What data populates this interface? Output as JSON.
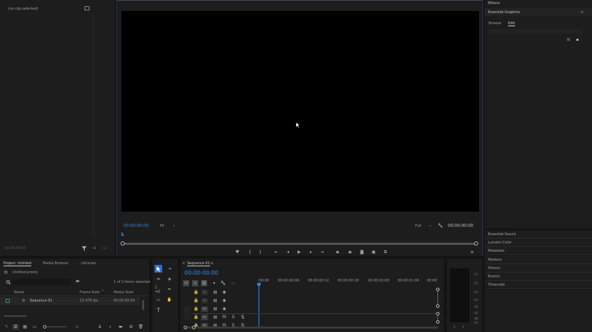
{
  "source_panel": {
    "title": "(no clip selected)",
    "bottom_left": "00:00:00:00"
  },
  "program": {
    "timecode_left": "00:00:00:00",
    "fit": "Fit",
    "quality": "Full",
    "timecode_right": "00:00:00:00"
  },
  "effects_panel": {
    "title": "Effects",
    "essential_graphics": "Essential Graphics",
    "tabs": [
      "Browse",
      "Edit"
    ],
    "active_tab": "Edit"
  },
  "right_panels": [
    "Essential Sound",
    "Lumetri Color",
    "Metadata",
    "Markers",
    "History",
    "Events",
    "Timecode"
  ],
  "project": {
    "tabs": [
      "Project: Untitled",
      "Media Browser",
      "Libraries"
    ],
    "file": "Untitled.prproj",
    "item_count": "1 of 2 items selected",
    "columns": [
      "Name",
      "Frame Rate",
      "Media Start"
    ],
    "rows": [
      {
        "name": "Sequence 01",
        "frame_rate": "23.976 fps",
        "media_start": "00:00:00:00"
      }
    ]
  },
  "timeline": {
    "tab": "Sequence 01",
    "timecode": "00:00:00:00",
    "ruler": [
      ":00:00",
      "00:00:00:06",
      "00:00:00:12",
      "00:00:00:18",
      "00:00:01:00",
      "00:00:01:06",
      "00:00"
    ],
    "video_tracks": [
      "V3",
      "V2",
      "V1"
    ],
    "audio_tracks": [
      "A1",
      "A2"
    ],
    "track_toggles": [
      "M",
      "S"
    ]
  },
  "meter": {
    "scale": [
      "-12",
      "-18",
      "-24",
      "-30",
      "-36",
      "-42",
      "-48",
      "-54"
    ],
    "bottom": [
      "S",
      "S"
    ]
  },
  "colors": {
    "accent": "#2d8ceb",
    "panel": "#1d1d1d",
    "bg": "#141414"
  }
}
